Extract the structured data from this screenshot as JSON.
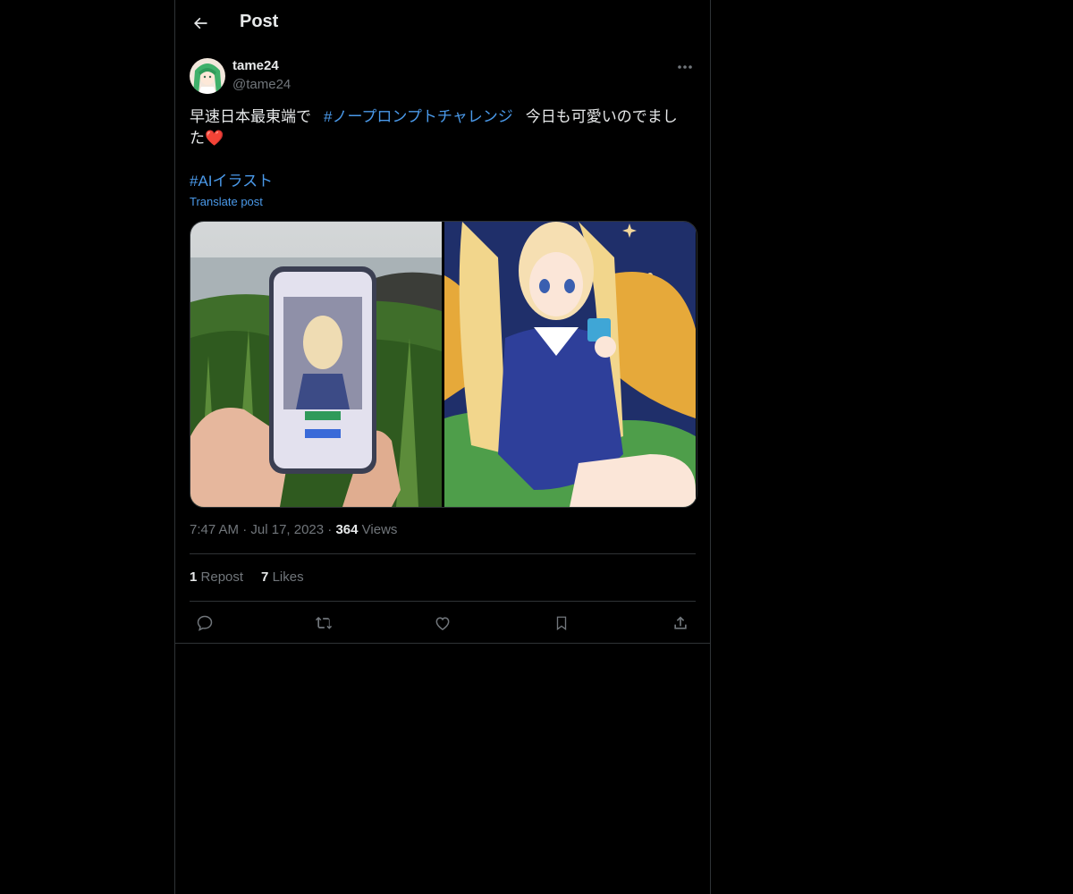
{
  "header": {
    "title": "Post",
    "back_icon": "arrow-left-icon"
  },
  "author": {
    "display_name": "tame24",
    "handle": "@tame24",
    "more_icon": "more-horizontal-icon"
  },
  "tweet": {
    "text_part1": "早速日本最東端で",
    "hashtag1": "#ノープロンプトチャレンジ",
    "text_part2": "今日も可愛いのでまし",
    "text_part3": "た",
    "emoji": "❤️",
    "hashtag2": "#AIイラスト",
    "translate_label": "Translate post"
  },
  "meta": {
    "time": "7:47 AM",
    "date": "Jul 17, 2023",
    "views_count": "364",
    "views_label": "Views",
    "separator": "·"
  },
  "stats": {
    "reposts_count": "1",
    "reposts_label": "Repost",
    "likes_count": "7",
    "likes_label": "Likes"
  },
  "actions": [
    "reply-icon",
    "repost-icon",
    "like-icon",
    "bookmark-icon",
    "share-icon"
  ],
  "colors": {
    "background": "#000000",
    "text": "#e7e9ea",
    "secondary": "#71767b",
    "link": "#4a99e9",
    "border": "#2f3336"
  }
}
